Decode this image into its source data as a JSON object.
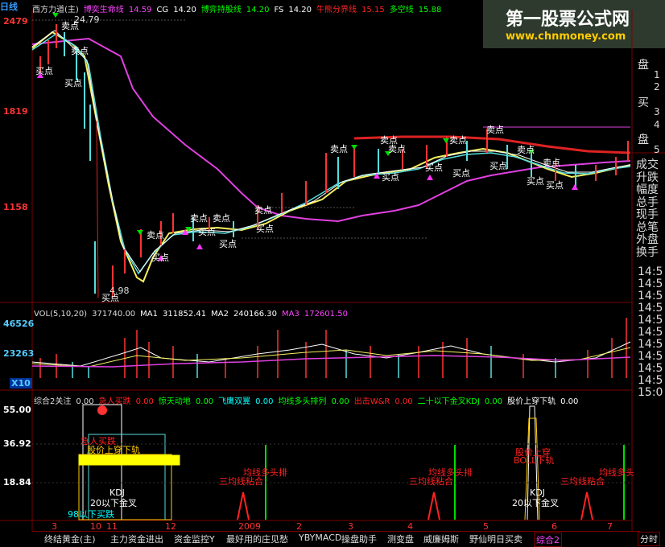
{
  "top_indicator": [
    {
      "text": "西方力道(主)",
      "color": "#dddddd"
    },
    {
      "text": "博奕生命线",
      "color": "#ff44ff"
    },
    {
      "text": "14.59",
      "color": "#ff44ff"
    },
    {
      "text": "CG",
      "color": "#ffffff"
    },
    {
      "text": "14.20",
      "color": "#ffffff"
    },
    {
      "text": "博弈持股线",
      "color": "#00ff00"
    },
    {
      "text": "14.20",
      "color": "#00ff00"
    },
    {
      "text": "FS",
      "color": "#ffffff"
    },
    {
      "text": "14.20",
      "color": "#ffffff"
    },
    {
      "text": "牛熊分界线",
      "color": "#ff2222"
    },
    {
      "text": "15.15",
      "color": "#ff2222"
    },
    {
      "text": "多空线",
      "color": "#00ff00"
    },
    {
      "text": "15.88",
      "color": "#00ff00"
    }
  ],
  "watermark": {
    "title": "第一股票公式网",
    "url": "www.chnmoney.com"
  },
  "period_label": "日线",
  "price_axis": {
    "top": "2479",
    "mid": "1819",
    "low": "1158"
  },
  "price_annotations": {
    "high": "24.79",
    "low": "4.98"
  },
  "signals": {
    "sell": "卖点",
    "buy": "买点"
  },
  "volume": {
    "header": [
      {
        "text": "VOL(5,10,20)",
        "color": "#dddddd"
      },
      {
        "text": "371740.00",
        "color": "#dddddd"
      },
      {
        "text": "MA1",
        "color": "#ffffff"
      },
      {
        "text": "311852.41",
        "color": "#ffffff"
      },
      {
        "text": "MA2",
        "color": "#ffffff"
      },
      {
        "text": "240166.30",
        "color": "#ffffff"
      },
      {
        "text": "MA3",
        "color": "#ff44ff"
      },
      {
        "text": "172601.50",
        "color": "#ff44ff"
      }
    ],
    "axis": {
      "top": "46526",
      "mid": "23263",
      "unit": "X10"
    }
  },
  "composite": {
    "header": [
      {
        "text": "综合2关注",
        "color": "#dddddd"
      },
      {
        "text": "0.00",
        "color": "#dddddd"
      },
      {
        "text": "急人买跌",
        "color": "#ff2222"
      },
      {
        "text": "0.00",
        "color": "#ff2222"
      },
      {
        "text": "惊天动地",
        "color": "#00ff00"
      },
      {
        "text": "0.00",
        "color": "#00ff00"
      },
      {
        "text": "飞鹰双翼",
        "color": "#00ffff"
      },
      {
        "text": "0.00",
        "color": "#00ffff"
      },
      {
        "text": "均线多头排列",
        "color": "#00ff00"
      },
      {
        "text": "0.00",
        "color": "#00ff00"
      },
      {
        "text": "出击W&R",
        "color": "#ff2222"
      },
      {
        "text": "0.00",
        "color": "#ff2222"
      },
      {
        "text": "二十以下金叉KDJ",
        "color": "#00ff00"
      },
      {
        "text": "0.00",
        "color": "#00ff00"
      },
      {
        "text": "股价上穿下轨",
        "color": "#ffffff"
      },
      {
        "text": "0.00",
        "color": "#ffffff"
      }
    ],
    "axis": {
      "top": "55.00",
      "mid": "36.92",
      "low": "18.84"
    },
    "labels": [
      {
        "text": "急人买跌",
        "color": "#ff2222"
      },
      {
        "text": "股价上穿下轨",
        "color": "#ffcc00"
      },
      {
        "text": "KDJ",
        "color": "#ffffff"
      },
      {
        "text": "20以下金叉",
        "color": "#ffffff"
      },
      {
        "text": "98以下买跌",
        "color": "#00ffff"
      },
      {
        "text": "均线多头排",
        "color": "#ff2222"
      },
      {
        "text": "三均线粘合",
        "color": "#ff2222"
      },
      {
        "text": "均线多头排",
        "color": "#ff2222"
      },
      {
        "text": "三均线粘合",
        "color": "#ff2222"
      },
      {
        "text": "股价上穿",
        "color": "#ff2222"
      },
      {
        "text": "BOLL下轨",
        "color": "#ff2222"
      },
      {
        "text": "KDJ",
        "color": "#ffffff"
      },
      {
        "text": "20以下金叉",
        "color": "#ffffff"
      },
      {
        "text": "三均线粘合",
        "color": "#ff2222"
      },
      {
        "text": "均线多头",
        "color": "#ff2222"
      }
    ]
  },
  "time_axis": [
    "3",
    "10",
    "11",
    "12",
    "2009",
    "2",
    "3",
    "4",
    "5",
    "6",
    "7"
  ],
  "right_panel": [
    "盘",
    "1",
    "2",
    "买",
    "3",
    "4",
    "盘",
    "5",
    "成交",
    "升跌",
    "幅度",
    "总手",
    "现手",
    "总笔",
    "外盘",
    "换手",
    "14:5",
    "14:5",
    "14:5",
    "14:5",
    "14:5",
    "14:5",
    "14:5",
    "14:5",
    "14:5",
    "14:5",
    "15:0"
  ],
  "tabs": [
    "终结黄金(主)",
    "主力资金进出",
    "资金监控Y",
    "最好用的庄见愁",
    "YBYMACD",
    "操盘助手",
    "测变盘",
    "威廉姆斯",
    "野仙明日买卖",
    "综合2"
  ],
  "bottom_right": "分时"
}
